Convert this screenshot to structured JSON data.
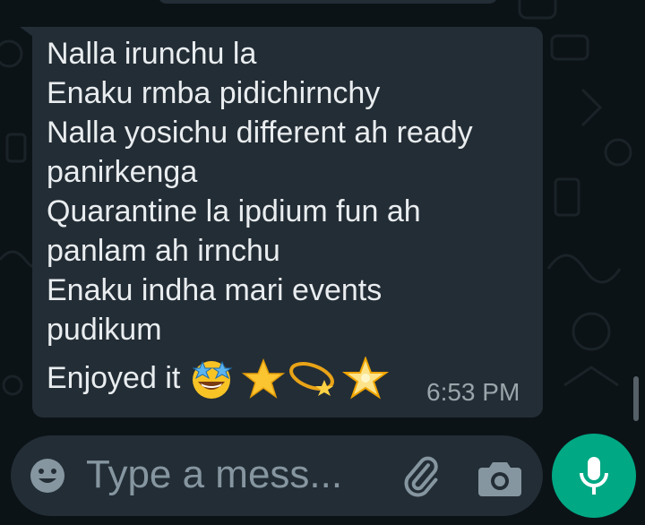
{
  "chat": {
    "message": {
      "lines": [
        "Nalla irunchu la",
        "Enaku rmba pidichirnchy",
        "Nalla yosichu different ah ready",
        "panirkenga",
        "Quarantine la ipdium fun ah",
        "panlam ah irnchu",
        "Enaku indha mari events",
        "pudikum",
        "Enjoyed it"
      ],
      "emojis": [
        "star-struck",
        "star",
        "dizzy",
        "glowing-star"
      ],
      "time": "6:53 PM"
    }
  },
  "composer": {
    "placeholder": "Type a mess..."
  },
  "colors": {
    "background": "#0c1317",
    "bubble": "#232d36",
    "text": "#e9edef",
    "muted": "#8696a0",
    "accent": "#00a884"
  },
  "icons": {
    "emoji": "smiley-icon",
    "attach": "paperclip-icon",
    "camera": "camera-icon",
    "mic": "mic-icon"
  }
}
